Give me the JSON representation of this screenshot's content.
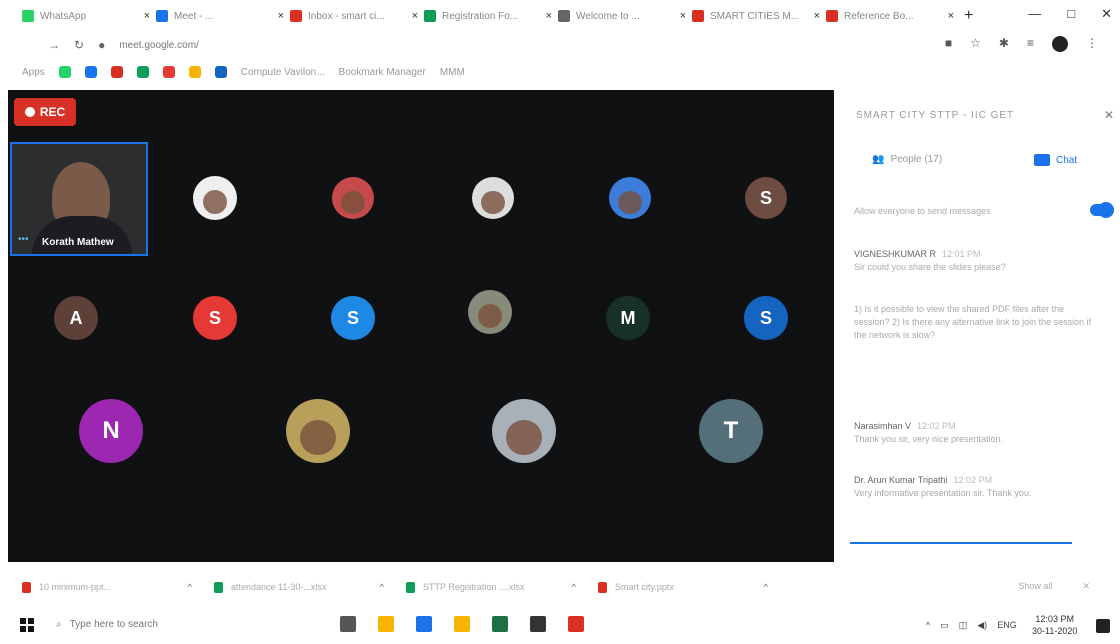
{
  "browser": {
    "tabs": [
      {
        "title": "WhatsApp",
        "color": "#25d366"
      },
      {
        "title": "Meet - ...",
        "color": "#1a73e8"
      },
      {
        "title": "Inbox - smart ci...",
        "color": "#d93025"
      },
      {
        "title": "Registration Fo...",
        "color": "#0f9d58"
      },
      {
        "title": "Welcome to ...",
        "color": "#666666"
      },
      {
        "title": "SMART CITIES M...",
        "color": "#d93025"
      },
      {
        "title": "Reference Bo...",
        "color": "#d93025"
      }
    ],
    "new_tab": "+",
    "window_controls": [
      "—",
      "□",
      "✕"
    ],
    "url": "meet.google.com/"
  },
  "bookmarks": {
    "apps_label": "Apps",
    "items": [
      "Compute Vavilon...",
      "Bookmark Manager",
      "MMM"
    ]
  },
  "meet": {
    "rec_label": "REC",
    "speaker_name": "Korath Mathew",
    "participants": [
      {
        "initial": "",
        "kind": "photo",
        "color": "#efefef"
      },
      {
        "initial": "",
        "kind": "photo",
        "color": "#c74a4a"
      },
      {
        "initial": "",
        "kind": "photo",
        "color": "#dddddd"
      },
      {
        "initial": "",
        "kind": "photo",
        "color": "#3b7dd8"
      },
      {
        "initial": "S",
        "kind": "letter",
        "color": "#6d4c41"
      },
      {
        "initial": "A",
        "kind": "letter",
        "color": "#5d4037"
      },
      {
        "initial": "S",
        "kind": "letter",
        "color": "#e53935"
      },
      {
        "initial": "S",
        "kind": "letter",
        "color": "#1e88e5"
      },
      {
        "initial": "",
        "kind": "photo",
        "color": "#8a8a7a"
      },
      {
        "initial": "M",
        "kind": "letter",
        "color": "#17302a"
      },
      {
        "initial": "S",
        "kind": "letter",
        "color": "#1565c0"
      },
      {
        "initial": "N",
        "kind": "letter",
        "color": "#9c27b0"
      },
      {
        "initial": "",
        "kind": "photo",
        "color": "#b8a05a"
      },
      {
        "initial": "",
        "kind": "photo",
        "color": "#a8b0b8"
      },
      {
        "initial": "T",
        "kind": "letter",
        "color": "#546e7a"
      }
    ]
  },
  "panel": {
    "title": "SMART CITY STTP - IIC GET",
    "people_tab": "People (17)",
    "chat_tab": "Chat",
    "toggle_label": "Allow everyone to send messages",
    "messages": [
      {
        "sender": "VIGNESHKUMAR R",
        "time": "12:01 PM",
        "text": "Sir could you share the slides please?"
      },
      {
        "sender": "",
        "time": "",
        "text": "1) Is it possible to view the shared PDF files after the session? 2) Is there any alternative link to join the session if the network is slow?"
      },
      {
        "sender": "Narasimhan V",
        "time": "12:02 PM",
        "text": "Thank you sir, very nice presentation."
      },
      {
        "sender": "Dr. Arun Kumar Tripathi",
        "time": "12:02 PM",
        "text": "Very informative presentation sir. Thank you."
      }
    ]
  },
  "downloads": {
    "items": [
      {
        "name": "10 minimum-ppt...",
        "color": "#d93025"
      },
      {
        "name": "attendance 11-30-...xlsx",
        "color": "#0f9d58"
      },
      {
        "name": "STTP Registration ....xlsx",
        "color": "#0f9d58"
      },
      {
        "name": "Smart city.pptx",
        "color": "#d93025"
      }
    ],
    "show_all": "Show all",
    "close": "✕"
  },
  "taskbar": {
    "search_placeholder": "Type here to search",
    "apps": [
      "#555555",
      "#f4b400",
      "#1a73e8",
      "#f4b400",
      "#1e7145",
      "#333333",
      "#d93025"
    ],
    "lang": "ENG",
    "time": "12:03 PM",
    "date": "30-11-2020"
  }
}
